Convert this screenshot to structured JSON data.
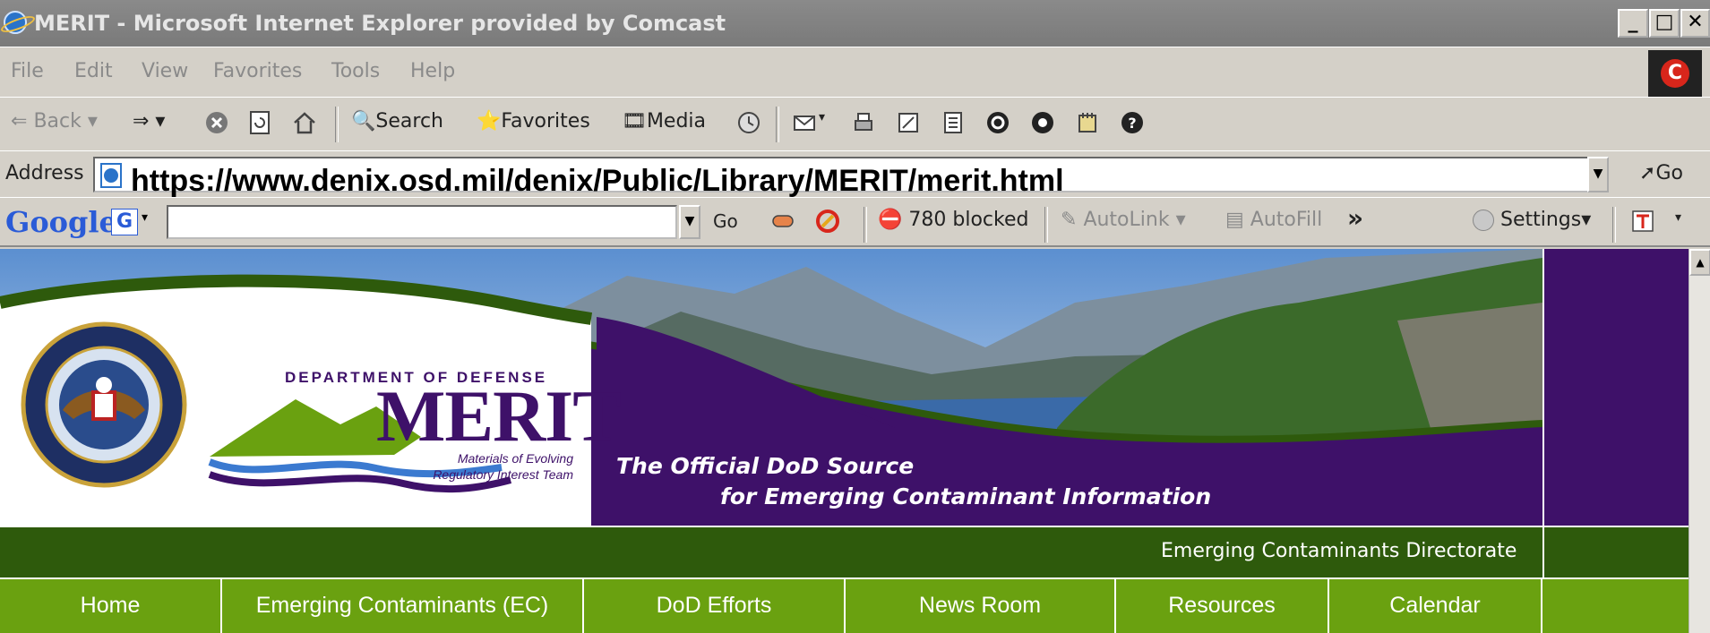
{
  "window": {
    "title": "MERIT - Microsoft Internet Explorer provided by Comcast",
    "minimize": "_",
    "maximize": "□",
    "close": "✕"
  },
  "menu": [
    "File",
    "Edit",
    "View",
    "Favorites",
    "Tools",
    "Help"
  ],
  "comcast_logo": "C",
  "toolbar": {
    "back": "Back",
    "search": "Search",
    "favorites": "Favorites",
    "media": "Media"
  },
  "address": {
    "label": "Address",
    "url": "https://www.denix.osd.mil/denix/Public/Library/MERIT/merit.html",
    "go": "Go"
  },
  "google_bar": {
    "logo": "Google",
    "g_button": "G",
    "go": "Go",
    "blocked": "780 blocked",
    "autolink": "AutoLink",
    "autofill": "AutoFill",
    "more": "»",
    "settings": "Settings"
  },
  "banner": {
    "dept": "DEPARTMENT OF DEFENSE",
    "merit": "MERIT",
    "sub_line1": "Materials of Evolving",
    "sub_line2": "Regulatory Interest Team",
    "tagline_line1": "The Official DoD Source",
    "tagline_line2": "for Emerging Contaminant Information"
  },
  "directorate": "Emerging Contaminants Directorate",
  "nav": [
    "Home",
    "Emerging Contaminants (EC)",
    "DoD Efforts",
    "News Room",
    "Resources",
    "Calendar"
  ],
  "colors": {
    "purple": "#3e1169",
    "dark_green": "#2e5a0c",
    "nav_green": "#6aa110"
  }
}
